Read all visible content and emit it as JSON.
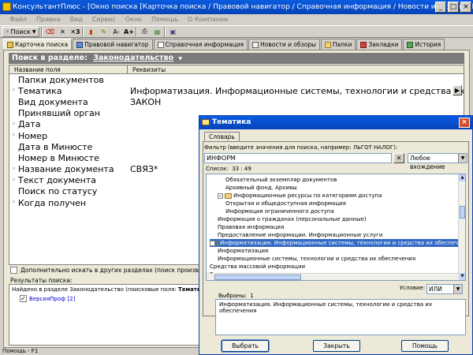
{
  "window": {
    "title": "КонсультантПлюс - [Окно поиска [Карточка поиска / Правовой навигатор / Справочная информация / Новости и обзоры / Папки / Закладки / И..."
  },
  "menu": [
    "Файл",
    "Правка",
    "Вид",
    "Сервис",
    "Окно",
    "Помощь",
    "О Компании"
  ],
  "toolbar": {
    "search_label": "Поиск"
  },
  "tabs": [
    {
      "label": "Карточка поиска",
      "icon": "search-card-icon",
      "active": true
    },
    {
      "label": "Правовой навигатор",
      "icon": "navigator-icon",
      "active": false
    },
    {
      "label": "Справочная информация",
      "icon": "reference-icon",
      "active": false
    },
    {
      "label": "Новости и обзоры",
      "icon": "news-icon",
      "active": false
    },
    {
      "label": "Папки",
      "icon": "folder-icon",
      "active": false
    },
    {
      "label": "Закладки",
      "icon": "bookmark-icon",
      "active": false
    },
    {
      "label": "История",
      "icon": "history-icon",
      "active": false
    }
  ],
  "section": {
    "prefix": "Поиск в разделе:",
    "name": "Законодательство"
  },
  "grid": {
    "col_field": "Название поля",
    "col_details": "Реквизиты",
    "rows": [
      {
        "field": "Папки документов",
        "value": "",
        "marked": false
      },
      {
        "field": "Тематика",
        "value": "Информатизация. Информационные системы, технологии и средства их обеспечения",
        "marked": true
      },
      {
        "field": "Вид документа",
        "value": "ЗАКОН",
        "marked": false
      },
      {
        "field": "Принявший орган",
        "value": "",
        "marked": false
      },
      {
        "field": "Дата",
        "value": "",
        "marked": true
      },
      {
        "field": "Номер",
        "value": "",
        "marked": true
      },
      {
        "field": "Дата в Минюсте",
        "value": "",
        "marked": false
      },
      {
        "field": "Номер в Минюсте",
        "value": "",
        "marked": false
      },
      {
        "field": "Название документа",
        "value": "СВЯЗ*",
        "marked": true
      },
      {
        "field": "Текст документа",
        "value": "",
        "marked": true
      },
      {
        "field": "Поиск по статусу",
        "value": "",
        "marked": false
      },
      {
        "field": "Когда получен",
        "value": "",
        "marked": true
      }
    ]
  },
  "extra_search": "Дополнительно искать в других разделах (поиск производится только по пе",
  "results": {
    "label": "Результаты поиска:",
    "line": "Найдено в разделе Законодательство (поисковые поля: ",
    "line_bold": "Тематика, Вид до",
    "item": "ВерсияПроф",
    "item_count": "[2]"
  },
  "statusbar": "Помощь - F1",
  "dialog": {
    "title": "Тематика",
    "tab": "Словарь",
    "filter_label": "Фильтр (введите значения для поиска, например: ЛЬГОТ НАЛОГ):",
    "filter_value": "ИНФОРМ",
    "match_mode": "Любое вхождение",
    "count_label": "Список:",
    "count_value": "33 : 49",
    "tree": [
      {
        "text": "Обязательный экземпляр документов",
        "indent": 2,
        "type": "leaf"
      },
      {
        "text": "Архивный фонд. Архивы",
        "indent": 2,
        "type": "leaf"
      },
      {
        "text": "Информационные ресурсы по категориям доступа",
        "indent": 1,
        "type": "folder"
      },
      {
        "text": "Открытая и общедоступная информация",
        "indent": 2,
        "type": "leaf"
      },
      {
        "text": "Информация ограниченного доступа",
        "indent": 2,
        "type": "leaf"
      },
      {
        "text": "Информация о гражданах (персональные данные)",
        "indent": 1,
        "type": "leaf"
      },
      {
        "text": "Правовая информация",
        "indent": 1,
        "type": "leaf"
      },
      {
        "text": "Предоставление информации. Информационные услуги",
        "indent": 1,
        "type": "leaf"
      },
      {
        "text": "Информатизация. Информационные системы, технологии и средства их обеспечения",
        "indent": 0,
        "type": "folder",
        "selected": true
      },
      {
        "text": "Информатизация",
        "indent": 1,
        "type": "leaf"
      },
      {
        "text": "Информационные системы, технологии и средства их обеспечения",
        "indent": 1,
        "type": "leaf"
      },
      {
        "text": "Средства массовой информации",
        "indent": 0,
        "type": "leaf"
      },
      {
        "text": "Реклама",
        "indent": 0,
        "type": "leaf"
      }
    ],
    "condition_label": "Условие:",
    "condition_value": "ИЛИ",
    "selected_label": "Выбраны:",
    "selected_count": "1",
    "selected_item": "Информатизация. Информационные системы, технологии и средства их обеспечения",
    "buttons": {
      "choose": "Выбрать",
      "close": "Закрыть",
      "help": "Помощь"
    }
  }
}
